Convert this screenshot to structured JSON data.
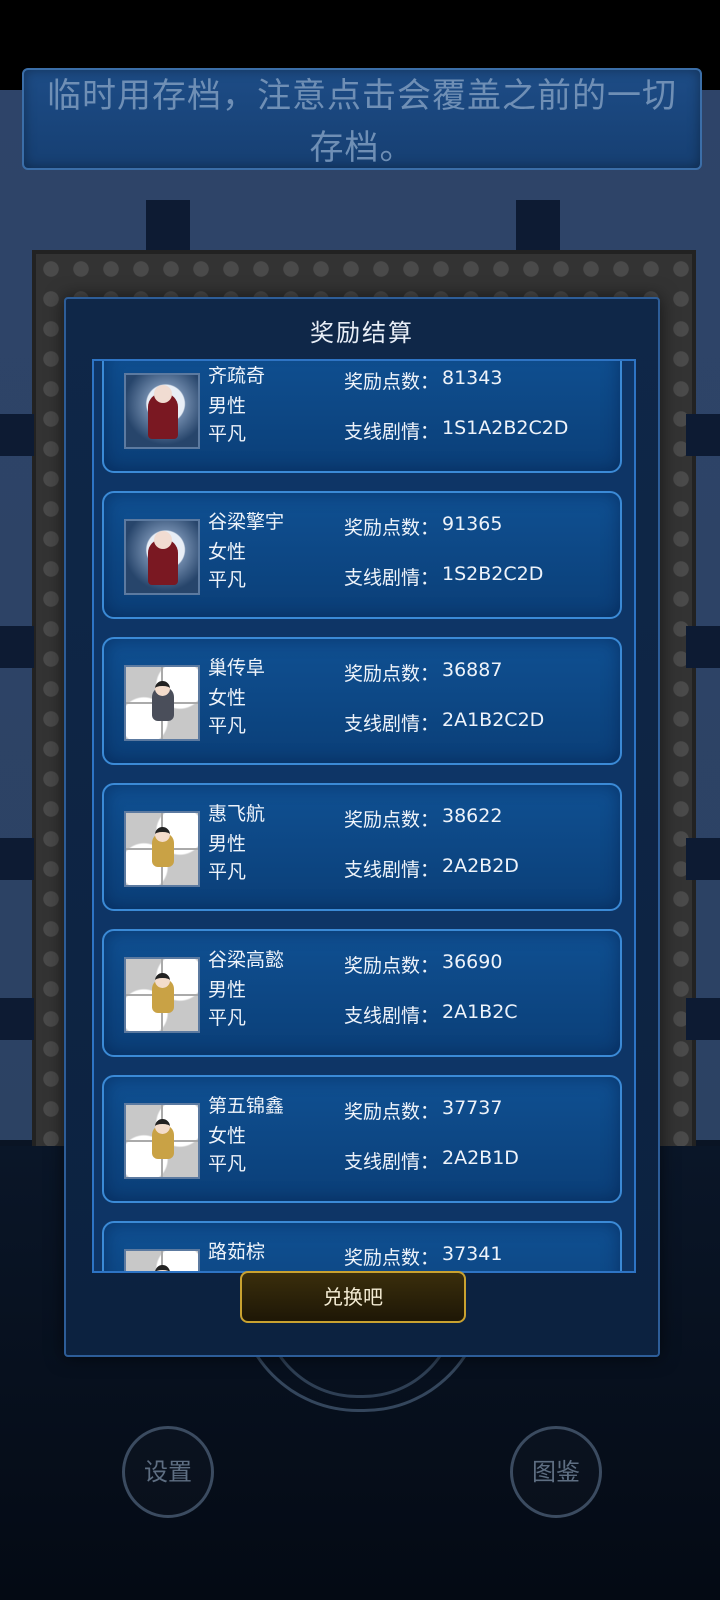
{
  "banner": {
    "line1": "临时用存档，注意点击会覆盖之前的一切",
    "line2": "存档。"
  },
  "modal": {
    "title": "奖励结算",
    "points_label": "奖励点数：",
    "branch_label": "支线剧情：",
    "entries": [
      {
        "name": "齐疏奇",
        "gender": "男性",
        "rank": "平凡",
        "points": "81343",
        "branch": "1S1A2B2C2D",
        "avatar": "moon-portrait-icon"
      },
      {
        "name": "谷梁擎宇",
        "gender": "女性",
        "rank": "平凡",
        "points": "91365",
        "branch": "1S2B2C2D",
        "avatar": "moon-portrait-icon"
      },
      {
        "name": "巢传阜",
        "gender": "女性",
        "rank": "平凡",
        "points": "36887",
        "branch": "2A1B2C2D",
        "avatar": "chibi-dark-icon"
      },
      {
        "name": "惠飞航",
        "gender": "男性",
        "rank": "平凡",
        "points": "38622",
        "branch": "2A2B2D",
        "avatar": "chibi-gold-icon"
      },
      {
        "name": "谷梁高懿",
        "gender": "男性",
        "rank": "平凡",
        "points": "36690",
        "branch": "2A1B2C",
        "avatar": "chibi-gold-icon"
      },
      {
        "name": "第五锦鑫",
        "gender": "女性",
        "rank": "平凡",
        "points": "37737",
        "branch": "2A2B1D",
        "avatar": "chibi-gold-icon"
      },
      {
        "name": "路茹棕",
        "gender": "",
        "rank": "",
        "points": "37341",
        "branch": "",
        "avatar": "chibi-gold-icon"
      }
    ],
    "exchange_label": "兑换吧"
  },
  "bottom": {
    "settings_label": "设置",
    "codex_label": "图鉴"
  },
  "colors": {
    "modal_bg": "#0c2240",
    "card_bg": "#0f5092",
    "card_border": "#3b8ad6",
    "button_border": "#c9a230"
  }
}
